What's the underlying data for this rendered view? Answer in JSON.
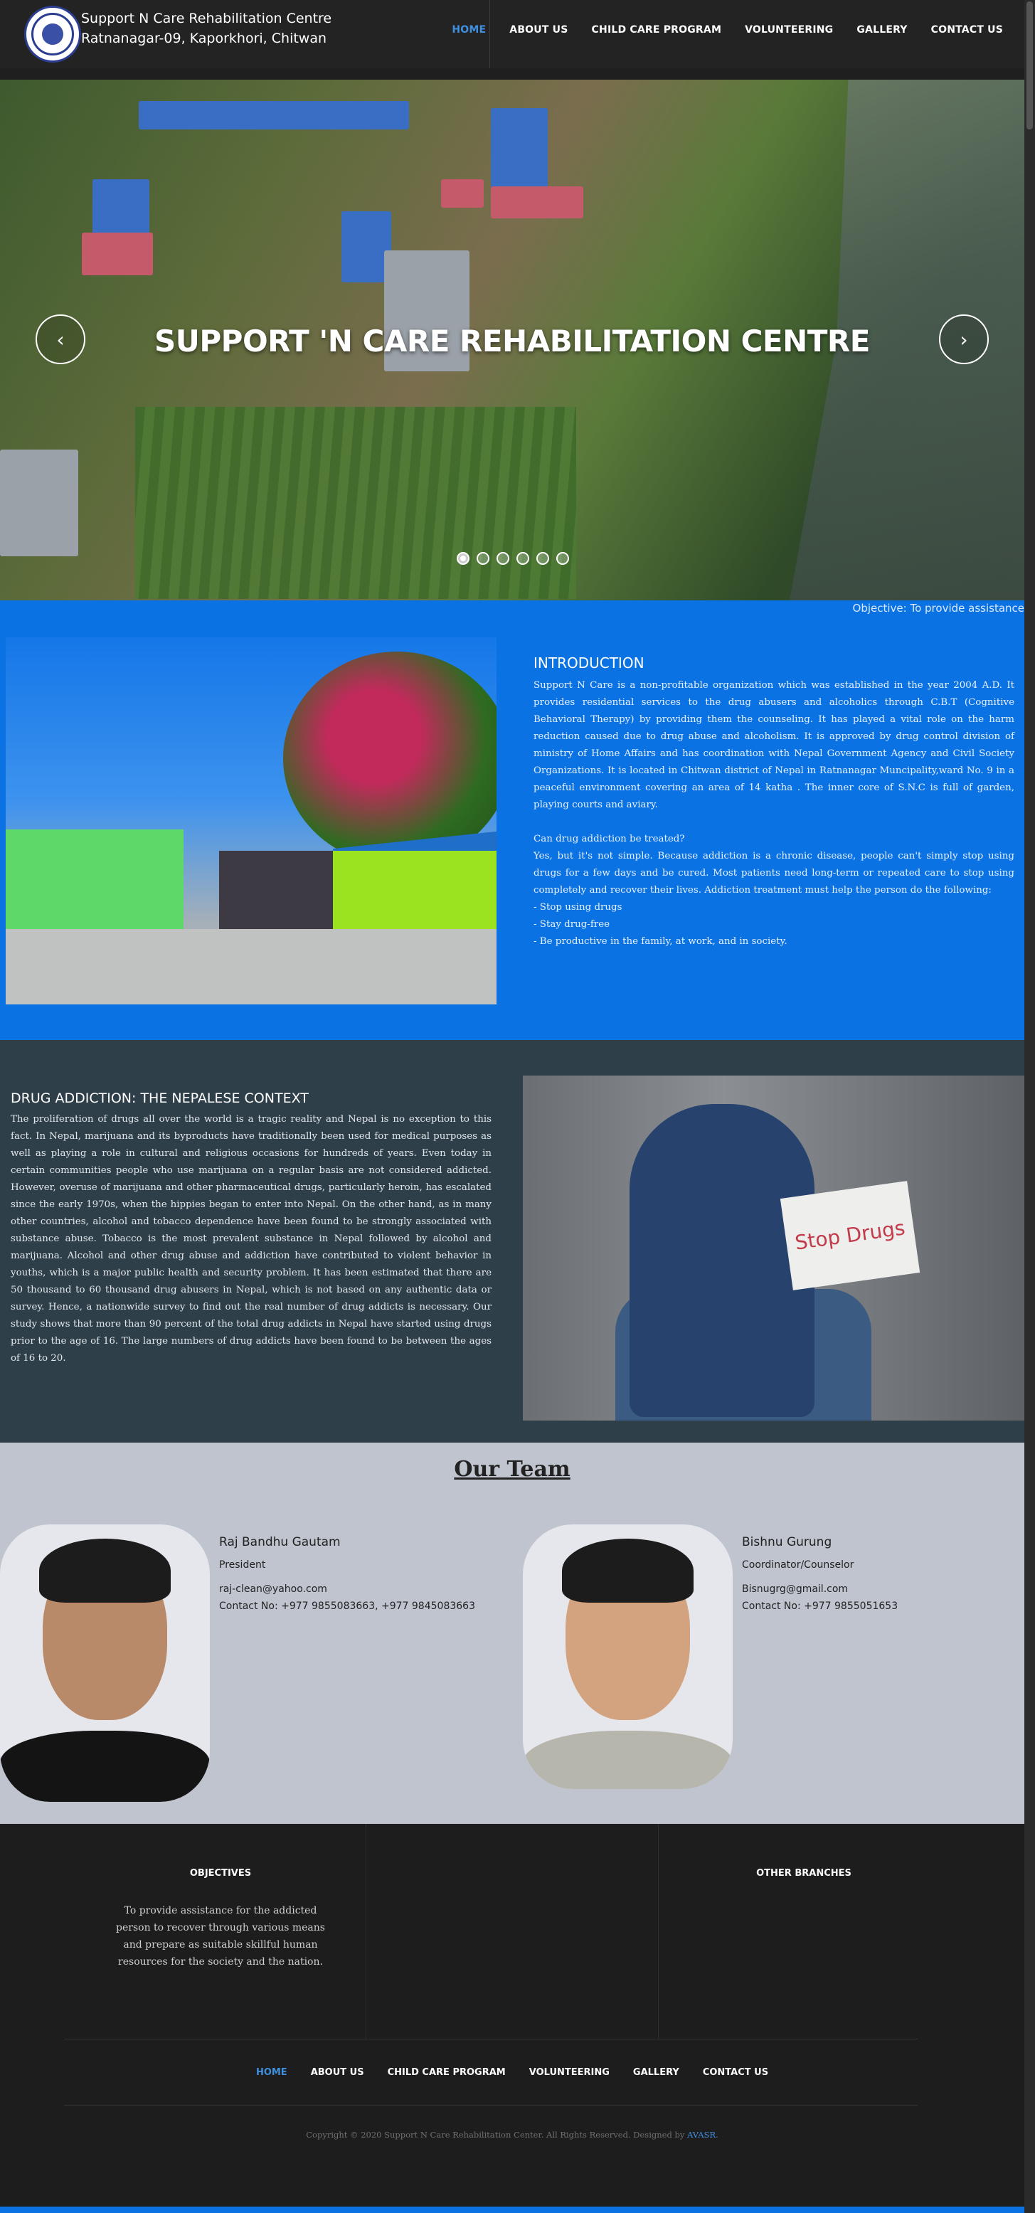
{
  "header": {
    "brand_line1": "Support N Care Rehabilitation Centre",
    "brand_line2": "Ratnanagar-09, Kaporkhori, Chitwan",
    "nav": [
      "HOME",
      "ABOUT US",
      "CHILD CARE PROGRAM",
      "VOLUNTEERING",
      "GALLERY",
      "CONTACT US"
    ],
    "active_nav": "HOME"
  },
  "hero": {
    "title": "SUPPORT 'N CARE REHABILITATION CENTRE",
    "prev_icon": "chevron-left-icon",
    "next_icon": "chevron-right-icon",
    "prev_glyph": "‹",
    "next_glyph": "›",
    "slide_count": 6,
    "active_slide": 1
  },
  "intro": {
    "marquee": "Objective: To provide assistance",
    "heading": "INTRODUCTION",
    "paragraph": "Support N Care is a non-profitable organization which was established in the year 2004 A.D. It provides residential services to the drug abusers and alcoholics through C.B.T (Cognitive Behavioral Therapy) by providing them the counseling. It has played a vital role on the harm reduction caused due to drug abuse and alcoholism. It is approved by drug control division of ministry of Home Affairs and has coordination with Nepal Government Agency and Civil Society Organizations. It is located in Chitwan district of Nepal in Ratnanagar Muncipality,ward No. 9 in a peaceful environment covering an area of 14 katha . The inner core of S.N.C is full of garden, playing courts and aviary.",
    "question": "Can drug addiction be treated?",
    "answer": "Yes, but it's not simple. Because addiction is a chronic disease, people can't simply stop using drugs for a few days and be cured. Most patients need long-term or repeated care to stop using completely and recover their lives. Addiction treatment must help the person do the following:",
    "list": [
      "- Stop using drugs",
      "- Stay drug-free",
      "- Be productive in the family, at work, and in society."
    ]
  },
  "drug": {
    "heading": "DRUG ADDICTION: THE NEPALESE CONTEXT",
    "paragraph": "The proliferation of drugs all over the world is a tragic reality and Nepal is no exception to this fact. In Nepal, marijuana and its byproducts have traditionally been used for medical purposes as well as playing a role in cultural and religious occasions for hundreds of years. Even today in certain communities people who use marijuana on a regular basis are not considered addicted. However, overuse of marijuana and other pharmaceutical drugs, particularly heroin, has escalated since the early 1970s, when the hippies began to enter into Nepal. On the other hand, as in many other countries, alcohol and tobacco dependence have been found to be strongly associated with substance abuse. Tobacco is the most prevalent substance in Nepal followed by alcohol and marijuana. Alcohol and other drug abuse and addiction have contributed to violent behavior in youths, which is a major public health and security problem. It has been estimated that there are 50 thousand to 60 thousand drug abusers in Nepal, which is not based on any authentic data or survey. Hence, a nationwide survey to find out the real number of drug addicts is necessary. Our study shows that more than 90 percent of the total drug addicts in Nepal have started using drugs prior to the age of 16. The large numbers of drug addicts have been found to be between the ages of 16 to 20.",
    "sign_text": "Stop Drugs"
  },
  "team": {
    "heading": "Our Team",
    "members": [
      {
        "name": "Raj Bandhu Gautam",
        "role": "President",
        "email": "raj-clean@yahoo.com",
        "contact": "Contact No: +977 9855083663, +977 9845083663"
      },
      {
        "name": "Bishnu Gurung",
        "role": "Coordinator/Counselor",
        "email": "Bisnugrg@gmail.com",
        "contact": "Contact No: +977 9855051653"
      }
    ]
  },
  "footer": {
    "objectives_title": "OBJECTIVES",
    "objectives_text": "To provide assistance for the addicted person to recover through various means and prepare as suitable skillful human resources for the society and the nation.",
    "branches_title": "OTHER BRANCHES",
    "nav": [
      "HOME",
      "ABOUT US",
      "CHILD CARE PROGRAM",
      "VOLUNTEERING",
      "GALLERY",
      "CONTACT US"
    ],
    "copyright_prefix": "Copyright © 2020 Support N Care Rehabilitation Center. All Rights Reserved. Designed by",
    "designer": "AVASR."
  },
  "colors": {
    "accent": "#3f8fe0",
    "intro_bg": "#0a72e2",
    "drug_bg": "#2f3f49",
    "team_bg": "#c0c4cf",
    "footer_bg": "#1d1d1d"
  }
}
